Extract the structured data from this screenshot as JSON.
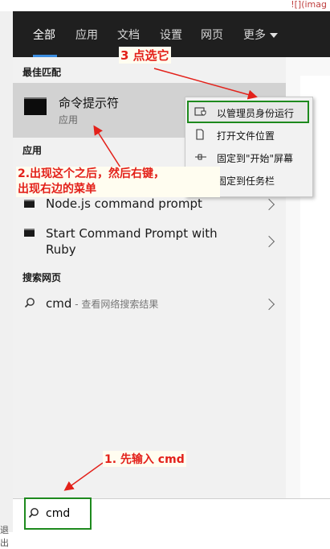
{
  "corner": {
    "top_right": "![](imag",
    "left_bottom": "退出"
  },
  "nav": {
    "tabs": [
      {
        "label": "全部",
        "active": true
      },
      {
        "label": "应用"
      },
      {
        "label": "文档"
      },
      {
        "label": "设置"
      },
      {
        "label": "网页"
      },
      {
        "label": "更多"
      }
    ]
  },
  "best_match": {
    "heading": "最佳匹配",
    "title": "命令提示符",
    "subtitle": "应用"
  },
  "apps": {
    "heading": "应用",
    "items": [
      "Node.js command prompt",
      "Start Command Prompt with Ruby"
    ]
  },
  "web": {
    "heading": "搜索网页",
    "query": "cmd",
    "hint": " - 查看网络搜索结果"
  },
  "search_box": {
    "value": "cmd"
  },
  "context_menu": {
    "items": [
      "以管理员身份运行",
      "打开文件位置",
      "固定到\"开始\"屏幕",
      "固定到任务栏"
    ]
  },
  "annotations": {
    "step1": "1. 先输入 cmd",
    "step2_line1": "2.出现这个之后，然后右键，",
    "step2_line2": "出现右边的菜单",
    "step3": "3 点选它"
  },
  "colors": {
    "accent_red": "#e3211a",
    "highlight_green": "#1e8a1e",
    "nav_bg": "#1f1f1f"
  }
}
